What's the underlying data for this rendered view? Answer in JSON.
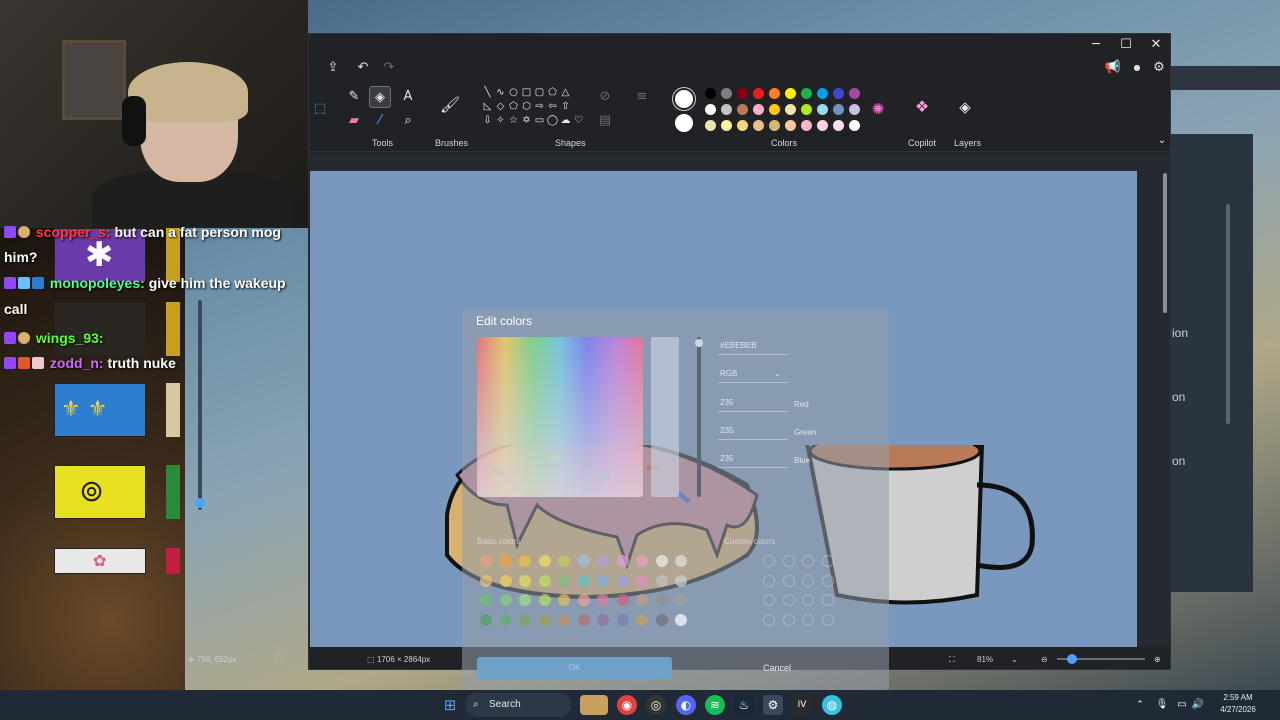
{
  "paint": {
    "window_controls": {
      "minimize": "─",
      "maximize": "☐",
      "close": "✕"
    },
    "groups": {
      "tools": "Tools",
      "brushes": "Brushes",
      "shapes": "Shapes",
      "colors": "Colors",
      "copilot": "Copilot",
      "layers": "Layers"
    },
    "palette": [
      "#000000",
      "#7f7f7f",
      "#880015",
      "#ed1c24",
      "#ff7f27",
      "#fff200",
      "#22b14c",
      "#00a2e8",
      "#3f48cc",
      "#a349a4",
      "#ffffff",
      "#c3c3c3",
      "#b97a57",
      "#ffaec9",
      "#ffc90e",
      "#efe4b0",
      "#b5e61d",
      "#99d9ea",
      "#7092be",
      "#c8bfe7",
      "#efe4b0",
      "#fff2a0",
      "#f5d680",
      "#e8c090",
      "#d4b87a",
      "#f8c8a0",
      "#f7b6c6",
      "#ffd0e0",
      "#ffe0f0",
      "#ffffff"
    ],
    "status": {
      "cursor_pos": "756, 652px",
      "canvas_size": "1706 × 2864px",
      "zoom": "81%"
    }
  },
  "dialog": {
    "title": "Edit colors",
    "hex": "#EBEBEB",
    "mode": "RGB",
    "red_value": "235",
    "red_label": "Red",
    "green_value": "235",
    "green_label": "Green",
    "blue_value": "235",
    "blue_label": "Blue",
    "basic_colors_label": "Basic colors",
    "custom_colors_label": "Custom colors",
    "ok_label": "OK",
    "cancel_label": "Cancel",
    "basic_dots": [
      "#e8a080",
      "#f0a040",
      "#f0c040",
      "#f0e060",
      "#c0d060",
      "#a0c0e0",
      "#b0a0e0",
      "#e0a0e0",
      "#f0a0c0",
      "#f0f0f0",
      "#e0e0e0",
      "#f0c080",
      "#f0d060",
      "#e0e060",
      "#c0e060",
      "#80c080",
      "#60c0c0",
      "#80b0e0",
      "#a0a0e0",
      "#e090c0",
      "#c0c0c0",
      "#d0d0d0",
      "#70c070",
      "#80d080",
      "#a0e080",
      "#b0e060",
      "#e0c060",
      "#f0a090",
      "#e080a0",
      "#d06080",
      "#c0a080",
      "#909090",
      "#a0a0a0",
      "#50a060",
      "#60b070",
      "#80a060",
      "#a0a050",
      "#c09060",
      "#b07070",
      "#9070a0",
      "#7080b0",
      "#c0a060",
      "#707070",
      "#ffffff"
    ]
  },
  "chat": [
    {
      "user": "scopper_s:",
      "msg": "but can a fat person mog",
      "cont": "him?",
      "color": "#ff3b3b"
    },
    {
      "user": "monopoleyes:",
      "msg": "give him the wakeup",
      "cont": "call",
      "color": "#4cff9a"
    },
    {
      "user": "wings_93:",
      "msg": "",
      "color": "#5dff3b"
    },
    {
      "user": "zodd_n:",
      "msg": "truth nuke",
      "color": "#c86bff"
    }
  ],
  "background_window": {
    "items": [
      "ion",
      "on",
      "on"
    ]
  },
  "taskbar": {
    "search": "Search",
    "time": "2:59 AM",
    "date": "4/27/2026",
    "icons": [
      "windows-icon",
      "search-icon",
      "widgets-icon",
      "chrome-icon",
      "obs-icon",
      "discord-icon",
      "spotify-icon",
      "steam-icon",
      "settings-icon",
      "game-icon",
      "browser-icon"
    ]
  }
}
